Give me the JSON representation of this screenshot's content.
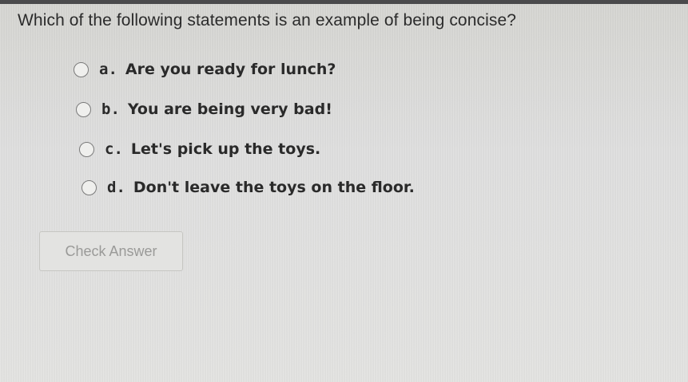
{
  "quiz": {
    "question": "Which of the following statements is an example of being concise?",
    "options": [
      {
        "letter": "a.",
        "text": "Are you ready for lunch?"
      },
      {
        "letter": "b.",
        "text": "You are being very bad!"
      },
      {
        "letter": "c.",
        "text": "Let's pick up the toys."
      },
      {
        "letter": "d.",
        "text": "Don't leave the toys on the floor."
      }
    ],
    "check_answer_label": "Check Answer"
  },
  "colors": {
    "background": "#dcdcd8",
    "text": "#2a2a2a",
    "button_text_disabled": "#9a9a98",
    "top_bar": "#4a4a4c"
  }
}
